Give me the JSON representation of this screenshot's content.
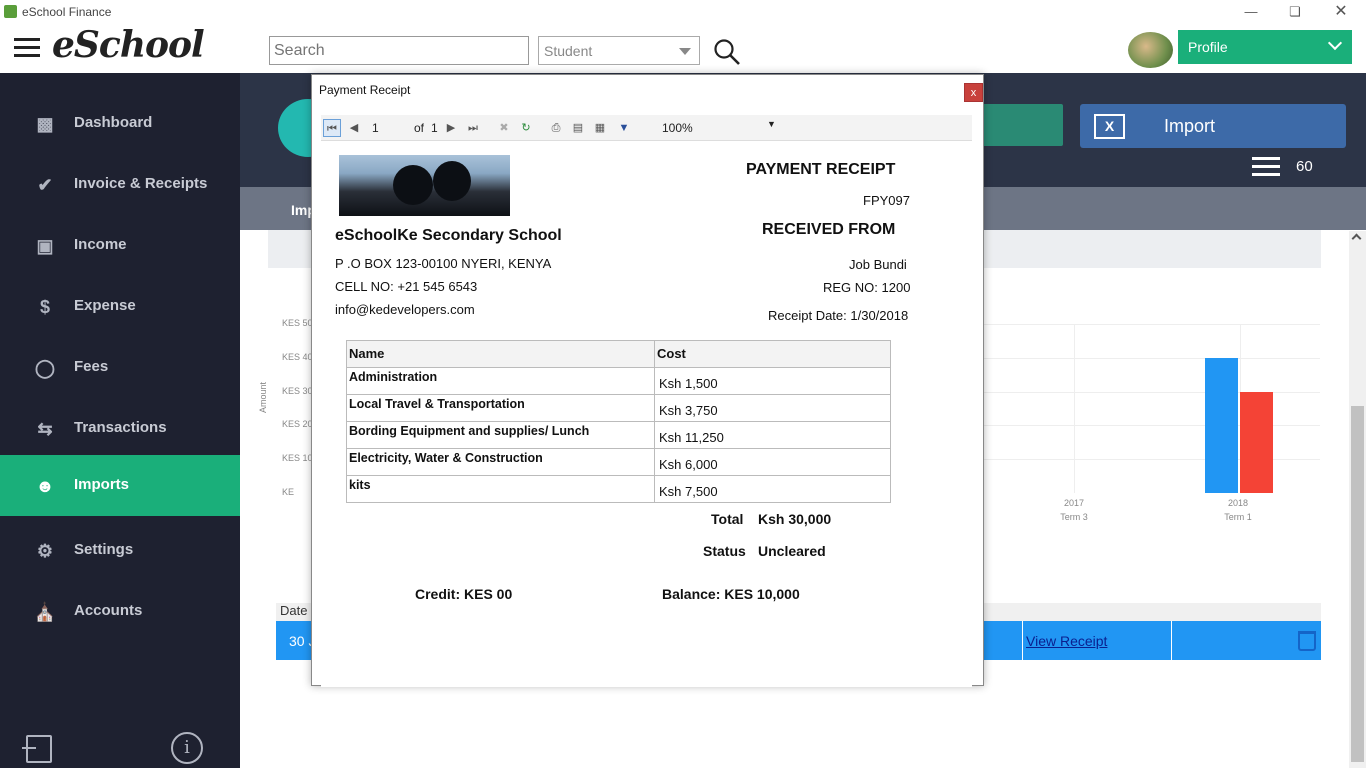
{
  "window": {
    "title": "eSchool Finance"
  },
  "header": {
    "logo": "eSchool",
    "search_placeholder": "Search",
    "student_select": "Student",
    "profile_label": "Profile"
  },
  "sidebar": {
    "items": [
      {
        "label": "Dashboard",
        "icon": "chart-icon"
      },
      {
        "label": "Invoice & Receipts",
        "icon": "check-circle-icon"
      },
      {
        "label": "Income",
        "icon": "money-icon"
      },
      {
        "label": "Expense",
        "icon": "shield-dollar-icon"
      },
      {
        "label": "Fees",
        "icon": "coins-icon"
      },
      {
        "label": "Transactions",
        "icon": "arrows-icon"
      },
      {
        "label": "Imports",
        "icon": "users-icon"
      },
      {
        "label": "Settings",
        "icon": "gear-icon"
      },
      {
        "label": "Accounts",
        "icon": "bank-icon"
      }
    ],
    "active": "Imports"
  },
  "main": {
    "import_button": "Import",
    "menu_count": "60",
    "subtab": "Imp",
    "table_header": "Date",
    "row_date": "30 J",
    "view_receipt": "View Receipt"
  },
  "chart_data": {
    "type": "bar",
    "ylabel": "Amount",
    "y_ticks": [
      "KES 50",
      "KES 40",
      "KES 30",
      "KES 20",
      "KES 10",
      "KE"
    ],
    "x_ticks": [
      {
        "year": "2017",
        "term": "Term 3"
      },
      {
        "year": "2018",
        "term": "Term 1"
      }
    ],
    "series": [
      {
        "color": "#2196f3",
        "values": [
          0,
          40000
        ]
      },
      {
        "color": "#f44336",
        "values": [
          0,
          30000
        ]
      }
    ],
    "ylim": [
      0,
      50000
    ]
  },
  "modal": {
    "title": "Payment Receipt",
    "close": "x",
    "toolbar": {
      "page": "1",
      "of_label": "of",
      "total_pages": "1",
      "zoom": "100%"
    },
    "receipt": {
      "heading": "PAYMENT RECEIPT",
      "number": "FPY097",
      "received_from": "RECEIVED FROM",
      "student_name": "Job Bundi",
      "reg_no": "REG NO: 1200",
      "receipt_date": "Receipt Date: 1/30/2018",
      "school_name": "eSchoolKe Secondary School",
      "address": "P .O BOX 123-00100 NYERI, KENYA",
      "cell": "CELL NO: +21 545 6543",
      "email": "info@kedevelopers.com",
      "columns": [
        "Name",
        "Cost"
      ],
      "rows": [
        {
          "name": "Administration",
          "cost": "Ksh 1,500"
        },
        {
          "name": "Local Travel & Transportation",
          "cost": "Ksh 3,750"
        },
        {
          "name": "Bording Equipment and supplies/ Lunch",
          "cost": "Ksh 11,250"
        },
        {
          "name": "Electricity, Water & Construction",
          "cost": "Ksh 6,000"
        },
        {
          "name": "kits",
          "cost": "Ksh 7,500"
        }
      ],
      "total_label": "Total",
      "total_value": "Ksh 30,000",
      "status_label": "Status",
      "status_value": "Uncleared",
      "credit": "Credit: KES 00",
      "balance": "Balance: KES 10,000"
    }
  }
}
